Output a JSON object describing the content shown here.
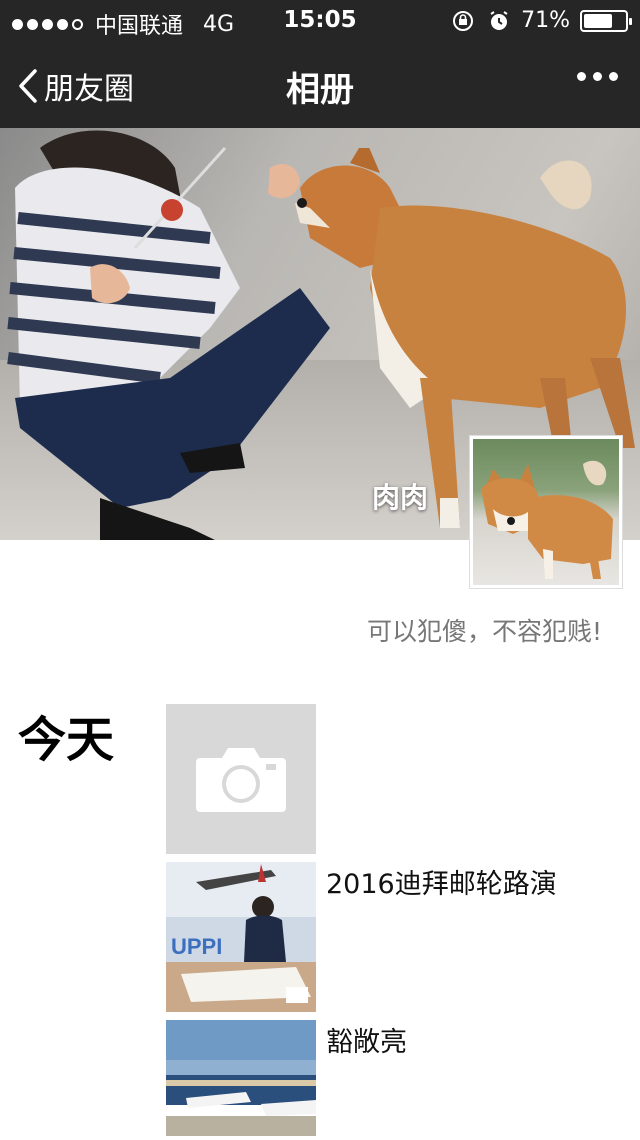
{
  "status_bar": {
    "carrier": "中国联通",
    "network": "4G",
    "time": "15:05",
    "battery": "71%",
    "battery_level": 0.71,
    "signal_bars_filled": 4
  },
  "nav": {
    "back_label": "朋友圈",
    "title": "相册"
  },
  "profile": {
    "name": "肉肉",
    "signature": "可以犯傻，不容犯贱!"
  },
  "feed": {
    "day_label": "今天",
    "posts": [
      {
        "caption": "2016迪拜邮轮路演"
      },
      {
        "caption": "豁敞亮"
      }
    ]
  },
  "colors": {
    "bar_bg": "#262626",
    "camera_tile_bg": "#d8d8d8"
  }
}
